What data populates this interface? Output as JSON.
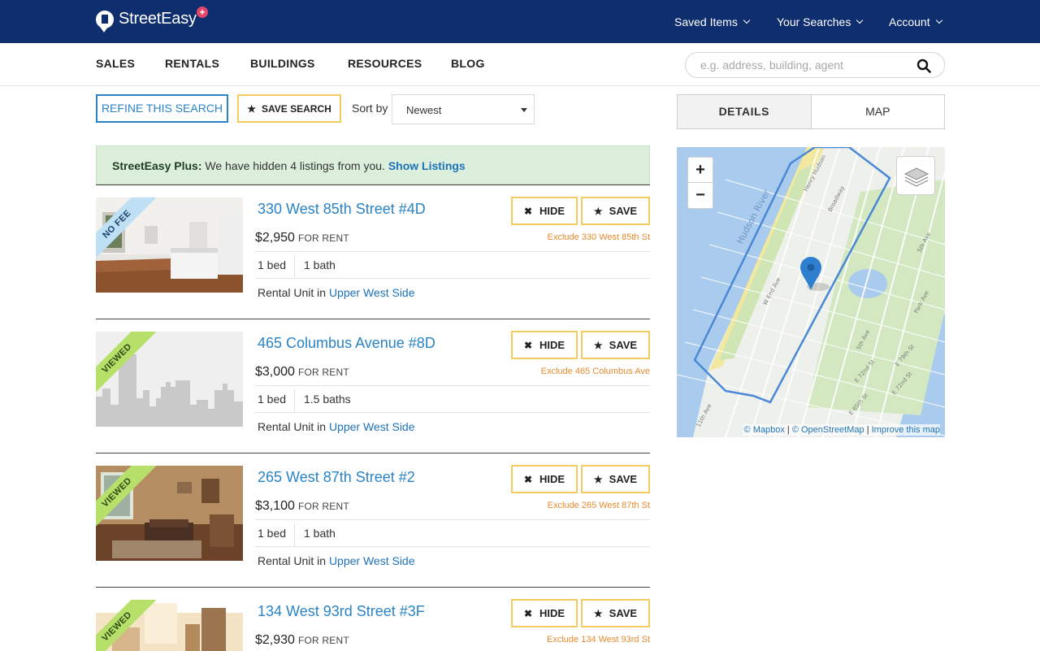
{
  "brand": {
    "name": "StreetEasy",
    "plus": "+"
  },
  "topnav": {
    "saved_items": "Saved Items",
    "your_searches": "Your Searches",
    "account": "Account"
  },
  "subnav": {
    "items": [
      "SALES",
      "RENTALS",
      "BUILDINGS",
      "RESOURCES",
      "BLOG"
    ],
    "search_placeholder": "e.g. address, building, agent"
  },
  "toolbar": {
    "refine": "REFINE THIS SEARCH",
    "save_search": "SAVE SEARCH",
    "sort_label": "Sort by",
    "sort_value": "Newest"
  },
  "notice": {
    "prefix": "StreetEasy Plus:",
    "text": " We have hidden 4 listings from you. ",
    "link": "Show Listings"
  },
  "listings": [
    {
      "title": "330 West 85th Street #4D",
      "price": "$2,950",
      "price_note": "FOR RENT",
      "beds": "1 bed",
      "baths": "1 bath",
      "type": "Rental Unit in ",
      "neighborhood": "Upper West Side",
      "ribbon": "NO FEE",
      "exclude": "Exclude 330 West 85th St",
      "hide": "HIDE",
      "save": "SAVE"
    },
    {
      "title": "465 Columbus Avenue #8D",
      "price": "$3,000",
      "price_note": "FOR RENT",
      "beds": "1 bed",
      "baths": "1.5 baths",
      "type": "Rental Unit in ",
      "neighborhood": "Upper West Side",
      "ribbon": "VIEWED",
      "exclude": "Exclude 465 Columbus Ave",
      "hide": "HIDE",
      "save": "SAVE"
    },
    {
      "title": "265 West 87th Street #2",
      "price": "$3,100",
      "price_note": "FOR RENT",
      "beds": "1 bed",
      "baths": "1 bath",
      "type": "Rental Unit in ",
      "neighborhood": "Upper West Side",
      "ribbon": "VIEWED",
      "exclude": "Exclude 265 West 87th St",
      "hide": "HIDE",
      "save": "SAVE"
    },
    {
      "title": "134 West 93rd Street #3F",
      "price": "$2,930",
      "price_note": "FOR RENT",
      "beds": "",
      "baths": "",
      "type": "",
      "neighborhood": "",
      "ribbon": "VIEWED",
      "exclude": "Exclude 134 West 93rd St",
      "hide": "HIDE",
      "save": "SAVE"
    }
  ],
  "panel": {
    "tab_details": "DETAILS",
    "tab_map": "MAP"
  },
  "map": {
    "zoom_in": "+",
    "zoom_out": "−",
    "attribution": [
      "© Mapbox",
      " | ",
      "© OpenStreetMap",
      " | ",
      "Improve this map"
    ],
    "labels": {
      "river": "Hudson River",
      "henry_hudson": "Henry Hudson",
      "broadway": "Broadway",
      "west_end": "W End Ave",
      "fifth_ave_top": "5th Ave",
      "fifth_ave": "5th Ave",
      "park_ave": "Park Ave",
      "e79": "E 79th St",
      "e72": "E 72nd St",
      "e65": "E 65th St",
      "e72b": "E 72nd St",
      "eleventh": "11th Ave"
    }
  },
  "colors": {
    "brand_navy": "#0f2e6e",
    "link_blue": "#2a83c7",
    "accent_yellow": "#f3cb5e",
    "exclude_orange": "#e88a2d",
    "notice_green": "#dcefdc",
    "ribbon_viewed": "#b6e06a",
    "ribbon_nofee": "#bfe0f4"
  }
}
